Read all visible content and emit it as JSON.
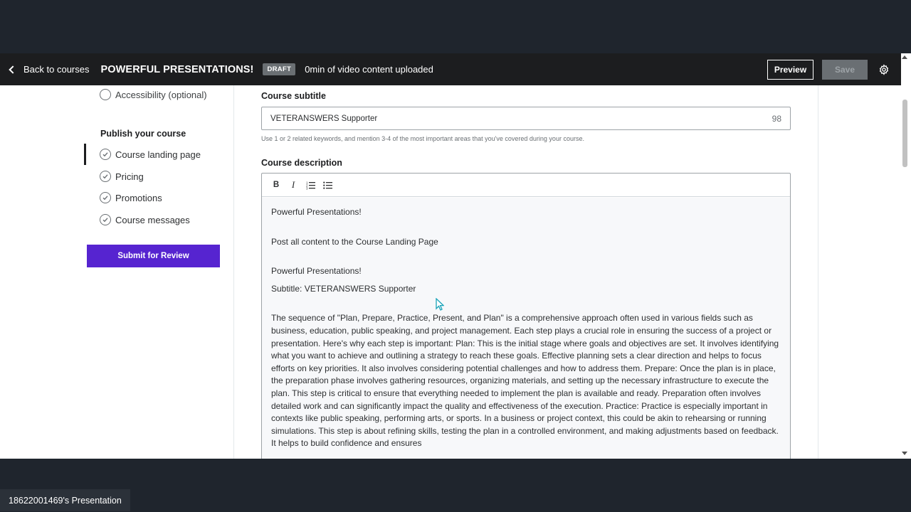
{
  "header": {
    "back_label": "Back to courses",
    "course_title": "POWERFUL PRESENTATIONS!",
    "status_badge": "DRAFT",
    "upload_status": "0min of video content uploaded",
    "preview_label": "Preview",
    "save_label": "Save"
  },
  "sidebar": {
    "accessibility_label": "Accessibility (optional)",
    "publish_heading": "Publish your course",
    "items": [
      {
        "label": "Course landing page"
      },
      {
        "label": "Pricing"
      },
      {
        "label": "Promotions"
      },
      {
        "label": "Course messages"
      }
    ],
    "submit_label": "Submit for Review"
  },
  "form": {
    "subtitle_label": "Course subtitle",
    "subtitle_value": "VETERANSWERS Supporter",
    "subtitle_remaining": "98",
    "subtitle_hint": "Use 1 or 2 related keywords, and mention 3-4 of the most important areas that you've covered during your course.",
    "description_label": "Course description",
    "toolbar": {
      "bold": "B",
      "italic": "I"
    },
    "description": {
      "line1": "Powerful Presentations!",
      "line2": "Post all content to the Course Landing Page",
      "line3": "Powerful Presentations!",
      "line4": "Subtitle: VETERANSWERS Supporter",
      "para": "The sequence of \"Plan, Prepare, Practice, Present, and Plan\" is a comprehensive approach often used in various fields such as business, education, public speaking, and project management. Each step plays a crucial role in ensuring the success of a project or presentation. Here's why each step is important: Plan: This is the initial stage where goals and objectives are set. It involves identifying what you want to achieve and outlining a strategy to reach these goals. Effective planning sets a clear direction and helps to focus efforts on key priorities. It also involves considering potential challenges and how to address them. Prepare: Once the plan is in place, the preparation phase involves gathering resources, organizing materials, and setting up the necessary infrastructure to execute the plan. This step is critical to ensure that everything needed to implement the plan is available and ready. Preparation often involves detailed work and can significantly impact the quality and effectiveness of the execution. Practice: Practice is especially important in contexts like public speaking, performing arts, or sports. In a business or project context, this could be akin to rehearsing or running simulations. This step is about refining skills, testing the plan in a controlled environment, and making adjustments based on feedback. It helps to build confidence and ensures"
    }
  },
  "footer": {
    "presentation_label": "18622001469's Presentation"
  },
  "colors": {
    "header_bg": "#1c1d1f",
    "accent_purple": "#5624d0",
    "outer_bg": "#1f252d"
  }
}
